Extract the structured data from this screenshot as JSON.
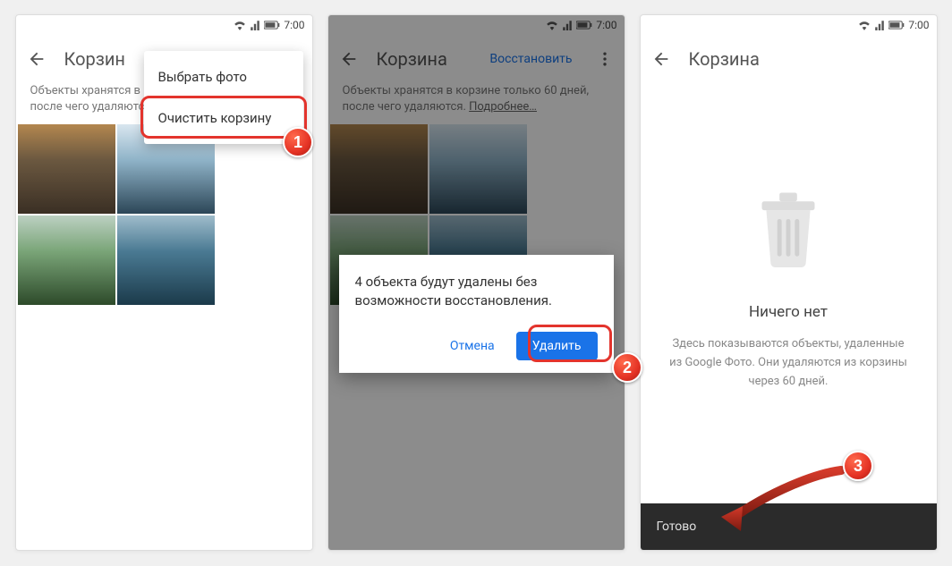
{
  "status": {
    "time": "7:00"
  },
  "screen1": {
    "title": "Корзин",
    "info": "Объекты хранятся в корзине только 60 дней, после чего удаляются.",
    "learn_more_visible": false,
    "menu": {
      "select_photo": "Выбрать фото",
      "empty_trash": "Очистить корзину"
    }
  },
  "screen2": {
    "title": "Корзина",
    "restore": "Восстановить",
    "info": "Объекты хранятся в корзине только 60 дней, после чего удаляются.",
    "learn_more": "Подробнее…",
    "dialog": {
      "message": "4 объекта будут удалены без возможности восстановления.",
      "cancel": "Отмена",
      "delete": "Удалить"
    }
  },
  "screen3": {
    "title": "Корзина",
    "empty_title": "Ничего нет",
    "empty_desc": "Здесь показываются объекты, удаленные из Google Фото. Они удаляются из корзины через 60 дней.",
    "done": "Готово"
  },
  "steps": {
    "s1": "1",
    "s2": "2",
    "s3": "3"
  }
}
